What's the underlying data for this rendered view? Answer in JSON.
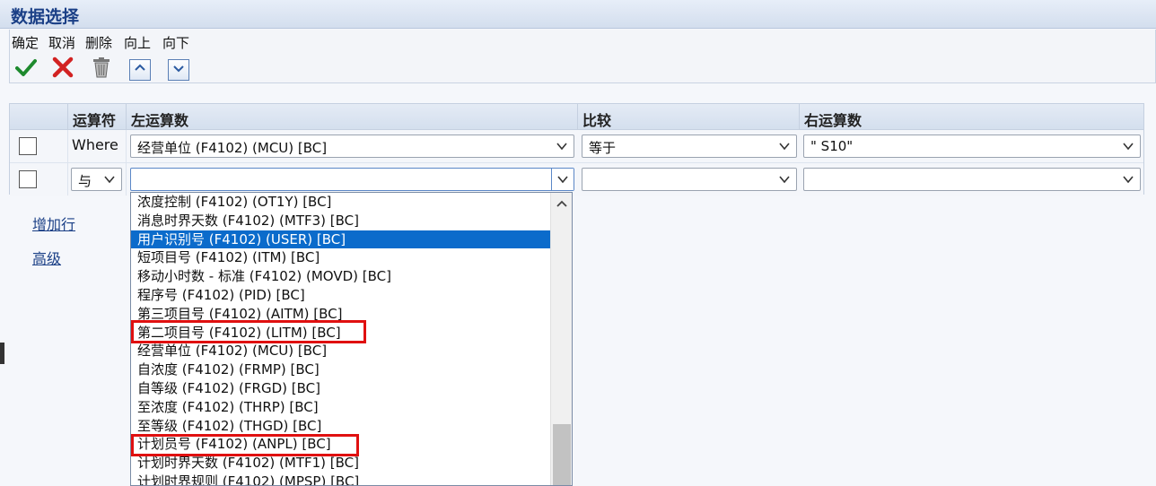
{
  "window": {
    "title": "数据选择"
  },
  "toolbar": {
    "ok_label": "确定",
    "cancel_label": "取消",
    "delete_label": "删除",
    "up_label": "向上",
    "down_label": "向下"
  },
  "grid": {
    "headers": {
      "operator": "运算符",
      "left_operand": "左运算数",
      "compare": "比较",
      "right_operand": "右运算数"
    },
    "rows": [
      {
        "operator": "Where",
        "left_operand": "经营单位 (F4102) (MCU) [BC]",
        "compare": "等于",
        "right_operand": "\" S10\""
      },
      {
        "operator": "与",
        "left_operand": "",
        "compare": "",
        "right_operand": ""
      }
    ]
  },
  "links": {
    "add_row": "增加行",
    "advanced": "高级"
  },
  "dropdown": {
    "items": [
      "浓度控制 (F4102) (OT1Y) [BC]",
      "消息时界天数 (F4102) (MTF3) [BC]",
      "用户识别号 (F4102) (USER) [BC]",
      "短项目号 (F4102) (ITM) [BC]",
      "移动小时数 - 标准 (F4102) (MOVD) [BC]",
      "程序号 (F4102) (PID) [BC]",
      "第三项目号 (F4102) (AITM) [BC]",
      "第二项目号 (F4102) (LITM) [BC]",
      "经营单位 (F4102) (MCU) [BC]",
      "自浓度 (F4102) (FRMP) [BC]",
      "自等级 (F4102) (FRGD) [BC]",
      "至浓度 (F4102) (THRP) [BC]",
      "至等级 (F4102) (THGD) [BC]",
      "计划员号 (F4102) (ANPL) [BC]",
      "计划时界天数 (F4102) (MTF1) [BC]",
      "计划时界规则 (F4102) (MPSP) [BC]"
    ],
    "selected_index": 2
  },
  "colors": {
    "accent": "#0b6bcb",
    "highlight": "#e01010",
    "title": "#1a3f86"
  }
}
